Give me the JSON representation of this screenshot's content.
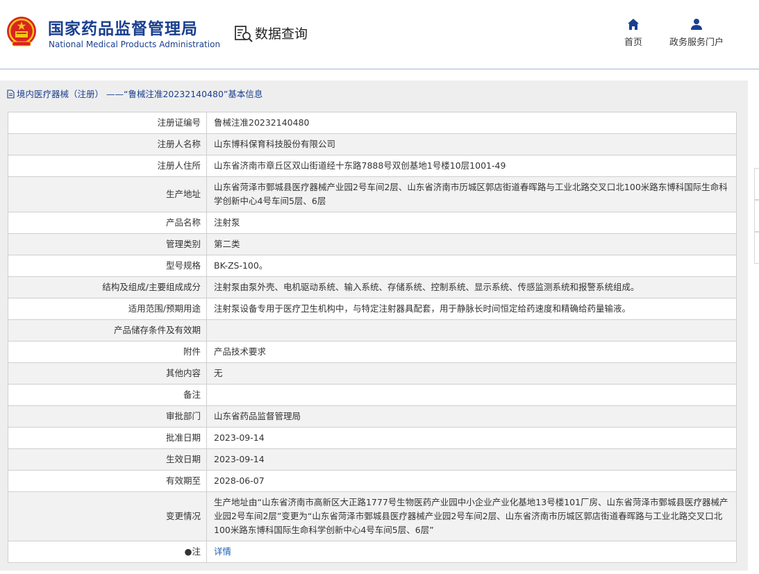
{
  "header": {
    "org_name_cn": "国家药品监督管理局",
    "org_name_en": "National Medical Products Administration",
    "query_title": "数据查询",
    "nav": [
      {
        "label": "首页",
        "icon": "home-icon"
      },
      {
        "label": "政务服务门户",
        "icon": "user-icon"
      }
    ]
  },
  "panel": {
    "title": "境内医疗器械（注册） ——“鲁械注准20232140480”基本信息",
    "icon": "document-icon"
  },
  "rows": [
    {
      "label": "注册证编号",
      "value": "鲁械注准20232140480"
    },
    {
      "label": "注册人名称",
      "value": "山东博科保育科技股份有限公司"
    },
    {
      "label": "注册人住所",
      "value": "山东省济南市章丘区双山街道经十东路7888号双创基地1号楼10层1001-49"
    },
    {
      "label": "生产地址",
      "value": "山东省菏泽市鄄城县医疗器械产业园2号车间2层、山东省济南市历城区郭店街道春晖路与工业北路交叉口北100米路东博科国际生命科学创新中心4号车间5层、6层"
    },
    {
      "label": "产品名称",
      "value": "注射泵"
    },
    {
      "label": "管理类别",
      "value": "第二类"
    },
    {
      "label": "型号规格",
      "value": "BK-ZS-100。"
    },
    {
      "label": "结构及组成/主要组成成分",
      "value": "注射泵由泵外壳、电机驱动系统、输入系统、存储系统、控制系统、显示系统、传感监测系统和报警系统组成。"
    },
    {
      "label": "适用范围/预期用途",
      "value": "注射泵设备专用于医疗卫生机构中，与特定注射器具配套，用于静脉长时间恒定给药速度和精确给药量输液。"
    },
    {
      "label": "产品储存条件及有效期",
      "value": ""
    },
    {
      "label": "附件",
      "value": "产品技术要求"
    },
    {
      "label": "其他内容",
      "value": "无"
    },
    {
      "label": "备注",
      "value": ""
    },
    {
      "label": "审批部门",
      "value": "山东省药品监督管理局"
    },
    {
      "label": "批准日期",
      "value": "2023-09-14"
    },
    {
      "label": "生效日期",
      "value": "2023-09-14"
    },
    {
      "label": "有效期至",
      "value": "2028-06-07"
    },
    {
      "label": "变更情况",
      "value": "生产地址由“山东省济南市高新区大正路1777号生物医药产业园中小企业产业化基地13号楼101厂房、山东省菏泽市鄄城县医疗器械产业园2号车间2层”变更为“山东省菏泽市鄄城县医疗器械产业园2号车间2层、山东省济南市历城区郭店街道春晖路与工业北路交叉口北100米路东博科国际生命科学创新中心4号车间5层、6层”"
    }
  ],
  "note_row": {
    "label": "●注",
    "link": "详情"
  },
  "colors": {
    "brand": "#1a3f8f",
    "link": "#1a5fb4",
    "row_shade": "#f2f2f2",
    "panel_bg": "#eeeeee"
  }
}
